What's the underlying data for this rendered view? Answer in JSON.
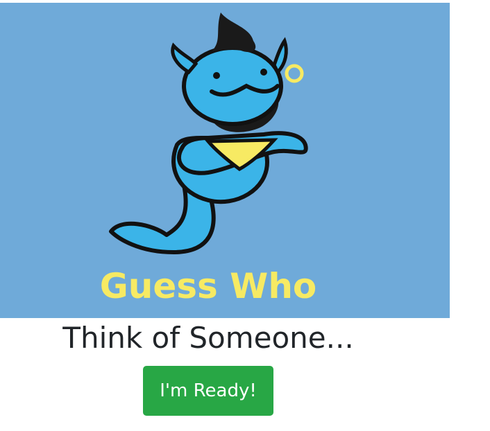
{
  "banner": {
    "brand_text": "Guess Who",
    "mascot_icon": "genie-mascot-icon",
    "background_color": "#6faad9",
    "brand_color": "#f7ea63"
  },
  "main": {
    "heading": "Think of Someone...",
    "ready_button_label": "I'm Ready!",
    "button_color": "#28a745"
  }
}
